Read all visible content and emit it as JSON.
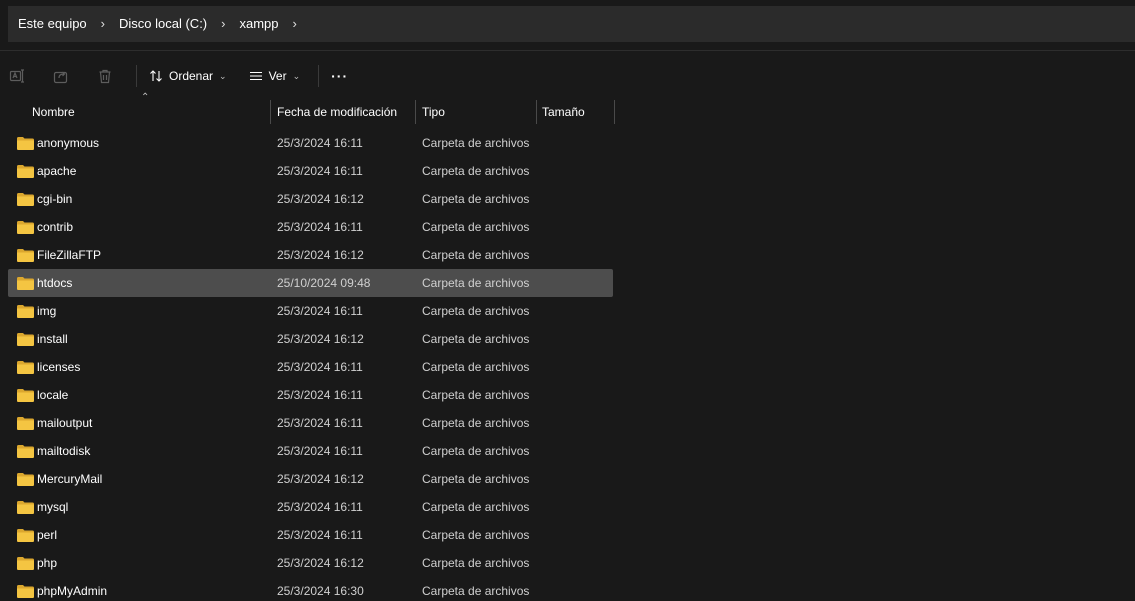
{
  "breadcrumb": {
    "items": [
      "Este equipo",
      "Disco local (C:)",
      "xampp"
    ],
    "separator": "›"
  },
  "toolbar": {
    "sort_label": "Ordenar",
    "view_label": "Ver",
    "more_label": "···"
  },
  "columns": {
    "name": "Nombre",
    "modified": "Fecha de modificación",
    "type": "Tipo",
    "size": "Tamaño"
  },
  "files": [
    {
      "name": "anonymous",
      "modified": "25/3/2024 16:11",
      "type": "Carpeta de archivos"
    },
    {
      "name": "apache",
      "modified": "25/3/2024 16:11",
      "type": "Carpeta de archivos"
    },
    {
      "name": "cgi-bin",
      "modified": "25/3/2024 16:12",
      "type": "Carpeta de archivos"
    },
    {
      "name": "contrib",
      "modified": "25/3/2024 16:11",
      "type": "Carpeta de archivos"
    },
    {
      "name": "FileZillaFTP",
      "modified": "25/3/2024 16:12",
      "type": "Carpeta de archivos"
    },
    {
      "name": "htdocs",
      "modified": "25/10/2024 09:48",
      "type": "Carpeta de archivos",
      "selected": true
    },
    {
      "name": "img",
      "modified": "25/3/2024 16:11",
      "type": "Carpeta de archivos"
    },
    {
      "name": "install",
      "modified": "25/3/2024 16:12",
      "type": "Carpeta de archivos"
    },
    {
      "name": "licenses",
      "modified": "25/3/2024 16:11",
      "type": "Carpeta de archivos"
    },
    {
      "name": "locale",
      "modified": "25/3/2024 16:11",
      "type": "Carpeta de archivos"
    },
    {
      "name": "mailoutput",
      "modified": "25/3/2024 16:11",
      "type": "Carpeta de archivos"
    },
    {
      "name": "mailtodisk",
      "modified": "25/3/2024 16:11",
      "type": "Carpeta de archivos"
    },
    {
      "name": "MercuryMail",
      "modified": "25/3/2024 16:12",
      "type": "Carpeta de archivos"
    },
    {
      "name": "mysql",
      "modified": "25/3/2024 16:11",
      "type": "Carpeta de archivos"
    },
    {
      "name": "perl",
      "modified": "25/3/2024 16:11",
      "type": "Carpeta de archivos"
    },
    {
      "name": "php",
      "modified": "25/3/2024 16:12",
      "type": "Carpeta de archivos"
    },
    {
      "name": "phpMyAdmin",
      "modified": "25/3/2024 16:30",
      "type": "Carpeta de archivos"
    }
  ],
  "icons": {
    "rename": "rename-icon",
    "share": "share-icon",
    "delete": "delete-icon",
    "sort": "sort-icon",
    "view": "view-icon",
    "folder": "folder-icon"
  },
  "colors": {
    "background": "#191919",
    "folder": "#f4c542",
    "selected_row": "#4d4d4d"
  }
}
